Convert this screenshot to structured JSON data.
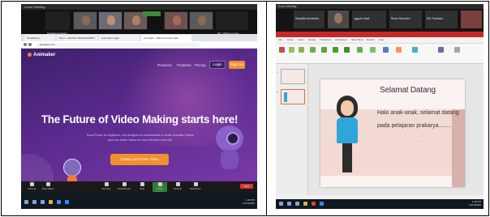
{
  "left": {
    "window_title": "Zoom Meeting",
    "gallery_names": [
      "Sasafika Annastria",
      "",
      "",
      "",
      "",
      "",
      "Ifal * Waria nur Osa...",
      ""
    ],
    "browser_tabs": [
      "Gmail/Inbox",
      "Zoom - DIGITAL MANAGEMENT",
      "Kumpulan tugas",
      "Animaker - Make Animated Vide...",
      ""
    ],
    "url": "animaker.com",
    "site": {
      "logo": "Animaker",
      "nav": [
        "Products",
        "Features",
        "Pricing"
      ],
      "login": "Login",
      "signup": "Sign Up",
      "headline": "The Future of Video Making starts here!",
      "subline_1": "Equal Power for beginners, non-designers & professionals to create Animated Videos",
      "subline_2": "and Live-Action videos for every Moment of our life.",
      "cta": "Create your Free Video",
      "chat_notice": "Hi, I'm Amy! Ask me anything!"
    },
    "zoom_controls": [
      "Unmute",
      "Start Video",
      "Security",
      "Participants",
      "Chat",
      "Share Screen",
      "Record",
      "Reactions"
    ],
    "end_label": "End",
    "tray_time": "1:48 PM",
    "tray_date": "10/10/2020"
  },
  "right": {
    "window_title": "Zoom Meeting",
    "gallery_names": [
      "Sasafika Annastria",
      "ngguin resat",
      "Rizal Octoviani",
      "DIL Farahani"
    ],
    "ribbon_tabs": [
      "File",
      "Home",
      "Insert",
      "Design",
      "Transitions",
      "Animations",
      "Slide Show",
      "Review",
      "View"
    ],
    "slide": {
      "title": "Selamat Datang",
      "lines": [
        "Halo anak-anak, selamat datang",
        "pada pelajaran prakarya........"
      ],
      "mark": "."
    },
    "tray_time": "1:48 PM",
    "tray_date": "10/10/2020"
  }
}
